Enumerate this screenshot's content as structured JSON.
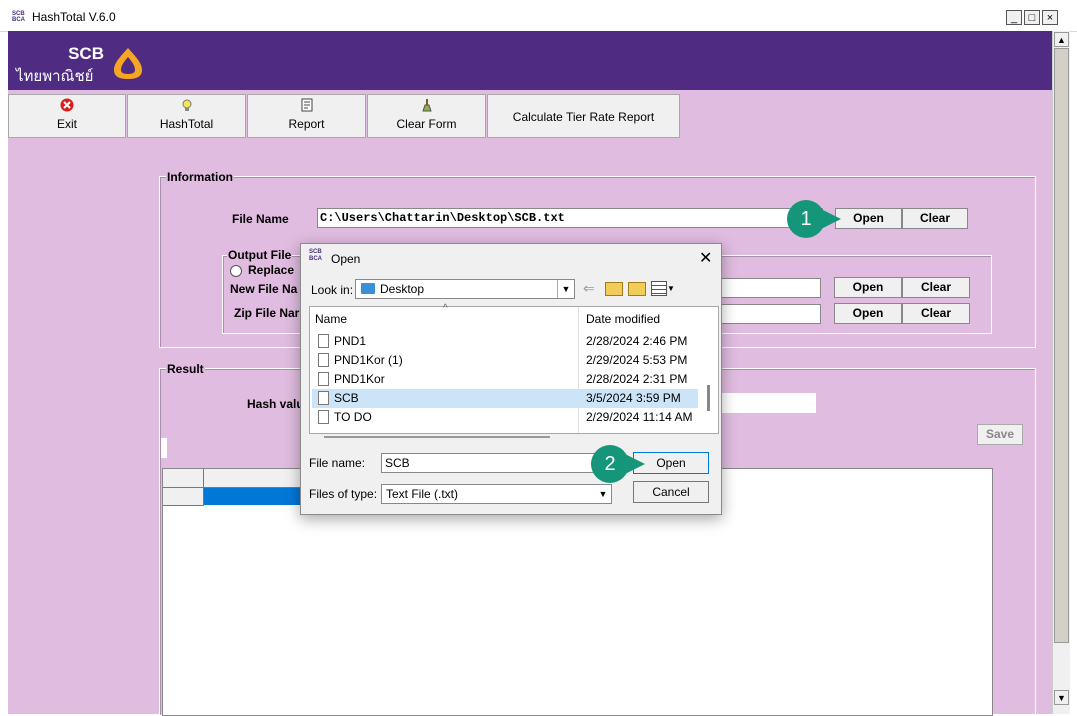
{
  "window": {
    "title": "HashTotal V.6.0",
    "icon_text": "SCB\nBCA",
    "min": "_",
    "max": "□",
    "close": "×"
  },
  "brand": {
    "name": "SCB",
    "thai": "ไทยพาณิชย์",
    "color": "#4f2c81"
  },
  "toolbar": [
    {
      "label": "Exit",
      "icon": "exit-icon"
    },
    {
      "label": "HashTotal",
      "icon": "bulb-icon"
    },
    {
      "label": "Report",
      "icon": "report-icon"
    },
    {
      "label": "Clear Form",
      "icon": "broom-icon"
    },
    {
      "label": "Calculate Tier Rate Report",
      "icon": ""
    }
  ],
  "information": {
    "legend": "Information",
    "file_name_label": "File Name",
    "file_name_value": "C:\\Users\\Chattarin\\Desktop\\SCB.txt",
    "open": "Open",
    "clear": "Clear",
    "output": {
      "legend": "Output File",
      "replace_label": "Replace",
      "new_file_label": "New File Na",
      "zip_file_label": "Zip File Nar",
      "open": "Open",
      "clear": "Clear"
    }
  },
  "result": {
    "legend": "Result",
    "hash_label": "Hash valu",
    "save": "Save"
  },
  "dialog": {
    "title": "Open",
    "look_in_label": "Look in:",
    "look_in_value": "Desktop",
    "columns": [
      "Name",
      "Date modified"
    ],
    "files": [
      {
        "name": "PND1",
        "date": "2/28/2024 2:46 PM",
        "selected": false
      },
      {
        "name": "PND1Kor (1)",
        "date": "2/29/2024 5:53 PM",
        "selected": false
      },
      {
        "name": "PND1Kor",
        "date": "2/28/2024 2:31 PM",
        "selected": false
      },
      {
        "name": "SCB",
        "date": "3/5/2024 3:59 PM",
        "selected": true
      },
      {
        "name": "TO DO",
        "date": "2/29/2024 11:14 AM",
        "selected": false
      }
    ],
    "file_name_label": "File name:",
    "file_name_value": "SCB",
    "file_type_label": "Files of type:",
    "file_type_value": "Text File (.txt)",
    "open": "Open",
    "cancel": "Cancel"
  },
  "callouts": [
    "1",
    "2"
  ],
  "colors": {
    "bg": "#e0bce0",
    "accent": "#15967a",
    "selection": "#0078d7"
  }
}
